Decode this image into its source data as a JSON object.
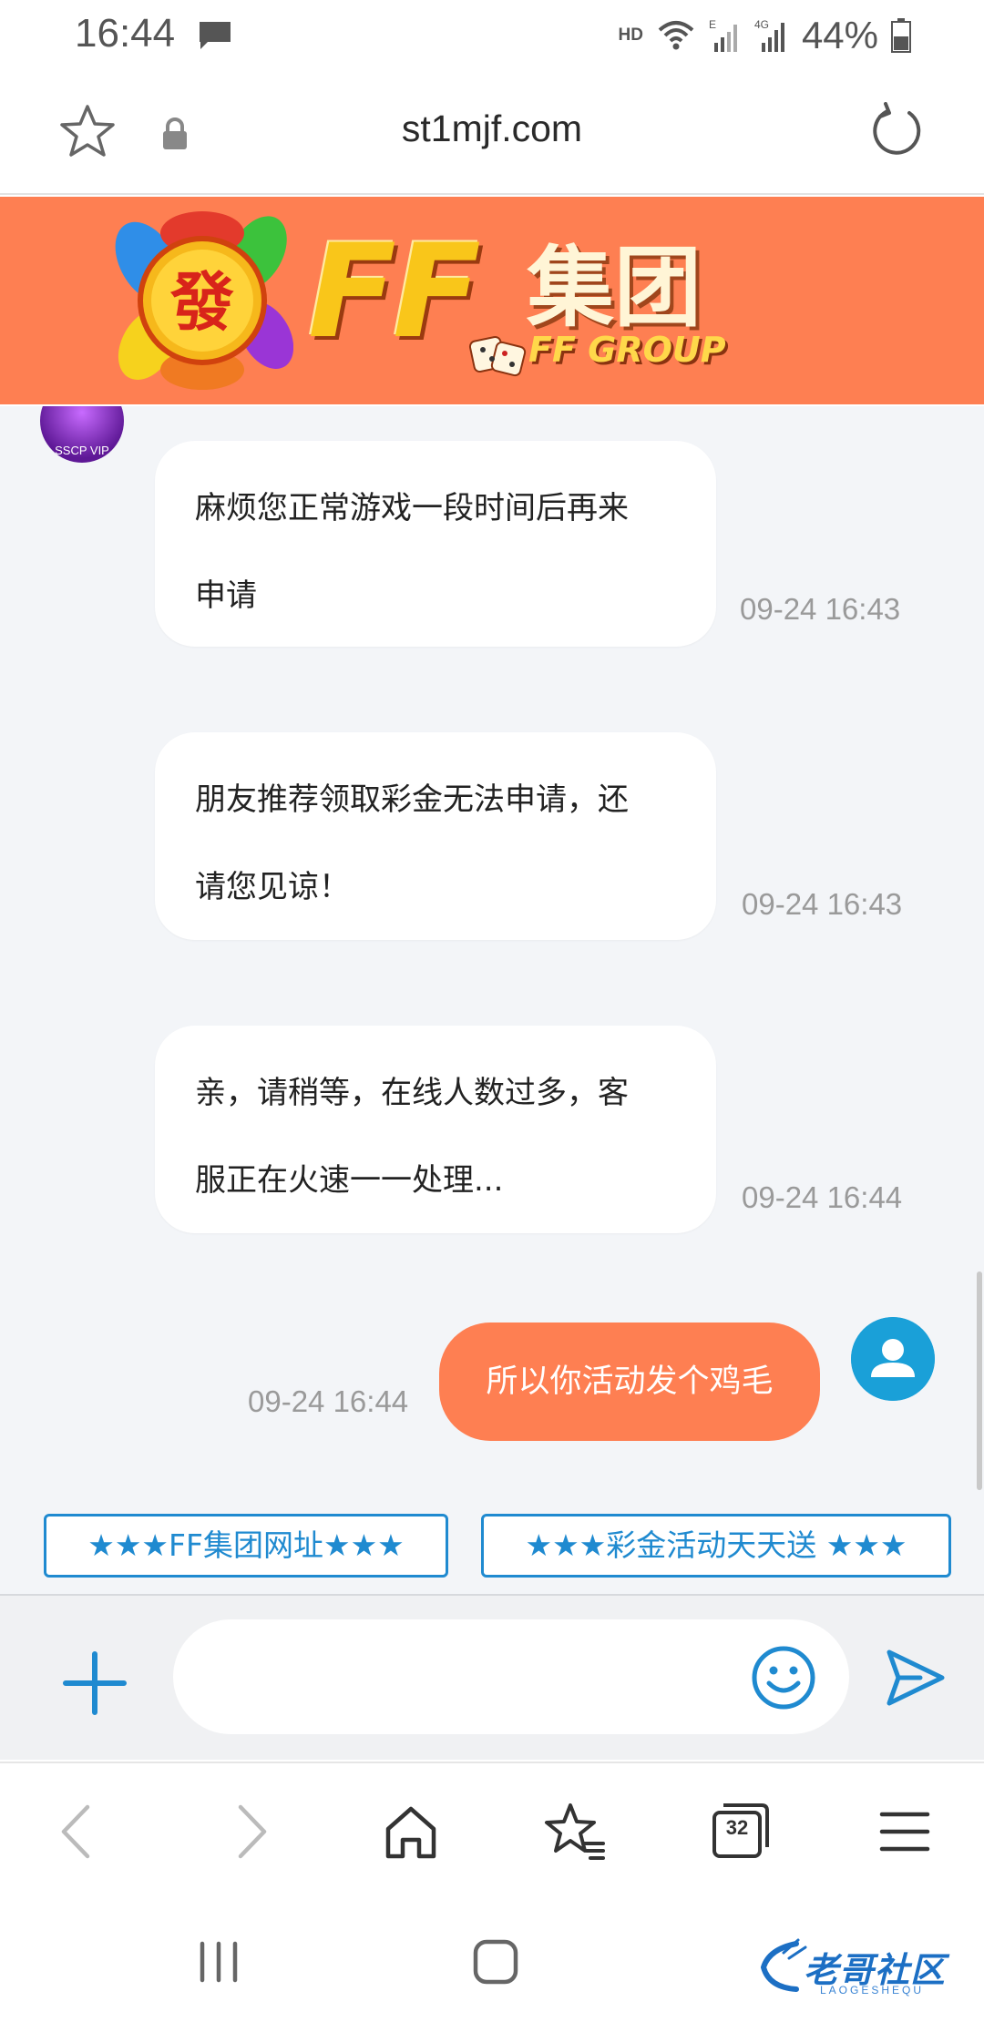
{
  "status_bar": {
    "time": "16:44",
    "hd_label": "HD",
    "battery_text": "44%",
    "icons": [
      "message-icon",
      "hd-icon",
      "wifi-icon",
      "signal-e-icon",
      "signal-4g-icon",
      "battery-icon"
    ]
  },
  "browser": {
    "url": "st1mjf.com"
  },
  "banner": {
    "logo_char": "發",
    "logo_ff": "FF",
    "logo_cn": "集团",
    "logo_en": "FF GROUP",
    "avatar_caption": "SSCP VIP",
    "bg_color": "#fe7f52"
  },
  "messages": [
    {
      "direction": "in",
      "lines": [
        "麻烦您正常游戏一段时间后再来",
        "申请"
      ],
      "time": "09-24 16:43"
    },
    {
      "direction": "in",
      "lines": [
        "朋友推荐领取彩金无法申请，还",
        "请您见谅！"
      ],
      "time": "09-24 16:43"
    },
    {
      "direction": "in",
      "lines": [
        "亲，请稍等，在线人数过多，客",
        "服正在火速一一处理..."
      ],
      "time": "09-24 16:44"
    },
    {
      "direction": "out",
      "lines": [
        "所以你活动发个鸡毛"
      ],
      "time": "09-24 16:44"
    }
  ],
  "quick_links": [
    {
      "label": "★★★FF集团网址★★★"
    },
    {
      "label": "★★★彩金活动天天送 ★★★"
    }
  ],
  "input": {
    "value": "",
    "placeholder": ""
  },
  "toolbar": {
    "tabs_count": "32"
  },
  "watermark": {
    "text": "老哥社区",
    "sub": "LAOGESHEQU"
  },
  "colors": {
    "accent": "#fe7f52",
    "link_blue": "#1f8ad0",
    "user_avatar": "#1aa0d8"
  }
}
